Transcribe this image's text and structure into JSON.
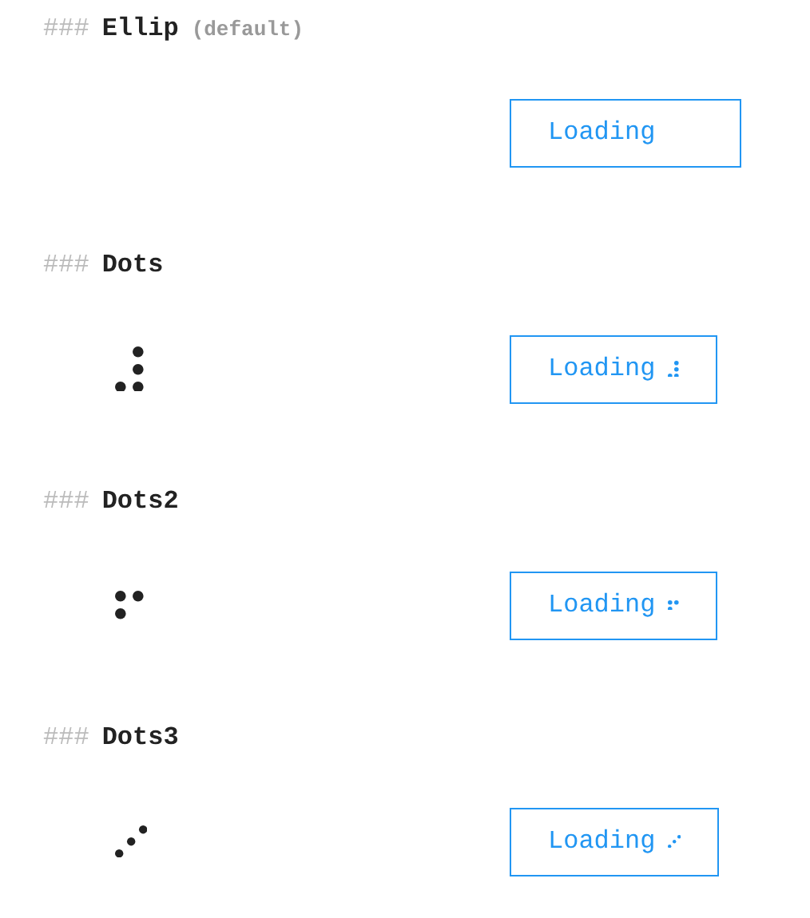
{
  "sections": [
    {
      "marker": "###",
      "title": "Ellip",
      "note": "(default)",
      "kind": "ellip",
      "button": "Loading"
    },
    {
      "marker": "###",
      "title": "Dots",
      "kind": "dots",
      "button": "Loading"
    },
    {
      "marker": "###",
      "title": "Dots2",
      "kind": "dots2",
      "button": "Loading"
    },
    {
      "marker": "###",
      "title": "Dots3",
      "kind": "dots3",
      "button": "Loading"
    }
  ]
}
